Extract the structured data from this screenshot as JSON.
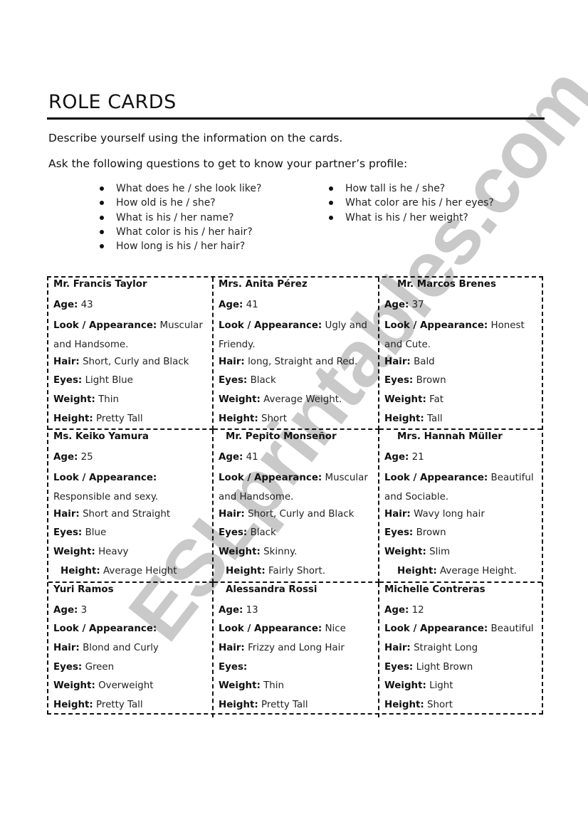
{
  "watermark": "ESLprintables.com",
  "title": "ROLE CARDS",
  "instructions": [
    "Describe yourself using the information on the cards.",
    "Ask the following questions to get to know your partner’s profile:"
  ],
  "questions": {
    "column1": [
      "What does he / she look like?",
      "How old is he / she?",
      "What is his / her name?",
      "What color is his / her hair?",
      "How long is his / her hair?"
    ],
    "column2": [
      "How tall is he / she?",
      "What color are his / her eyes?",
      "What is his / her weight?"
    ]
  },
  "labels": {
    "age": "Age:",
    "look": "Look / Appearance:",
    "hair": "Hair:",
    "eyes": "Eyes:",
    "weight": "Weight:",
    "height": "Height:"
  },
  "cards": [
    {
      "name": "Mr. Francis Taylor",
      "age": "43",
      "look": "Muscular and Handsome.",
      "hair": "Short, Curly and Black",
      "eyes": "Light Blue",
      "weight": "Thin",
      "height": "Pretty Tall"
    },
    {
      "name": "Mrs. Anita Pérez",
      "age": "41",
      "look": "Ugly and Friendy.",
      "hair": "long, Straight and Red.",
      "eyes": "Black",
      "weight": "Average Weight.",
      "height": "Short"
    },
    {
      "name": "Mr. Marcos Brenes",
      "age": "37",
      "look": "Honest and Cute.",
      "hair": "Bald",
      "eyes": "Brown",
      "weight": "Fat",
      "height": "Tall"
    },
    {
      "name": "Ms. Keiko Yamura",
      "age": "25",
      "look": "Responsible and sexy.",
      "hair": "Short and Straight",
      "eyes": "Blue",
      "weight": "Heavy",
      "height": "Average Height"
    },
    {
      "name": "Mr. Pepito Monseñor",
      "age": "41",
      "look": "Muscular and Handsome.",
      "hair": "Short, Curly and Black",
      "eyes": "Black",
      "weight": "Skinny.",
      "height": "Fairly Short."
    },
    {
      "name": "Mrs. Hannah Müller",
      "age": "21",
      "look": "Beautiful and Sociable.",
      "hair": "Wavy long hair",
      "eyes": "Brown",
      "weight": "Slim",
      "height": "Average Height."
    },
    {
      "name": "Yuri Ramos",
      "age": "3",
      "look": "",
      "hair": "Blond and Curly",
      "eyes": "Green",
      "weight": "Overweight",
      "height": "Pretty Tall"
    },
    {
      "name": "Alessandra Rossi",
      "age": "13",
      "look": "Nice",
      "hair": "Frizzy and Long Hair",
      "eyes": "",
      "weight": "Thin",
      "height": "Pretty Tall"
    },
    {
      "name": "Michelle Contreras",
      "age": "12",
      "look": "Beautiful",
      "hair": "Straight Long",
      "eyes": "Light Brown",
      "weight": "Light",
      "height": "Short"
    }
  ]
}
